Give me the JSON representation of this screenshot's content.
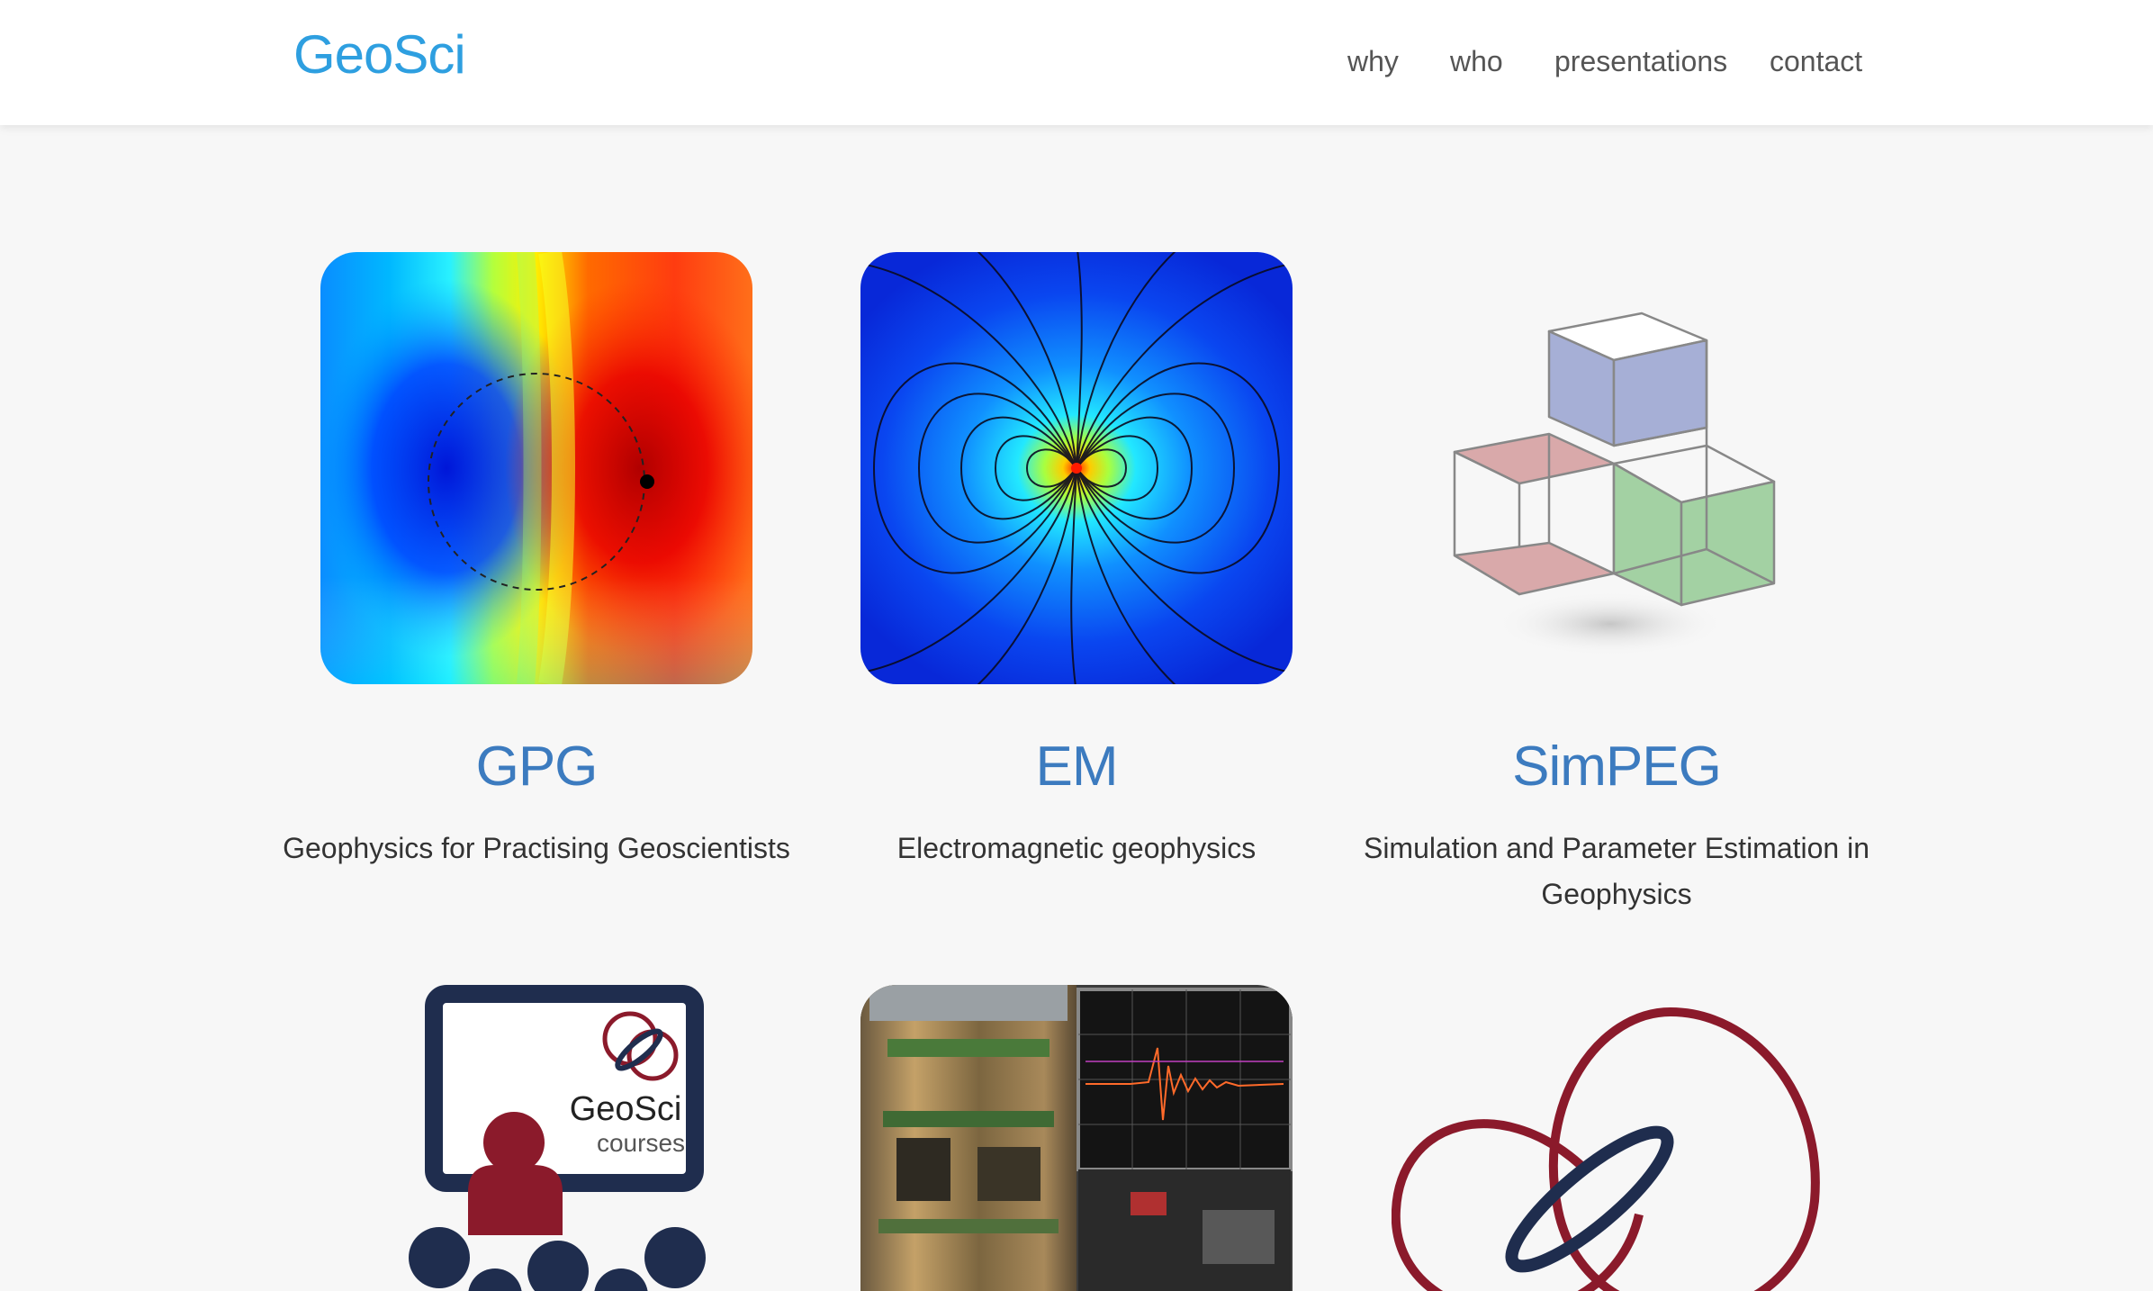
{
  "brand": "GeoSci",
  "nav": {
    "items": [
      "why",
      "who",
      "presentations",
      "contact"
    ]
  },
  "projects": [
    {
      "title": "GPG",
      "description": "Geophysics for Practising Geoscientists"
    },
    {
      "title": "EM",
      "description": "Electromagnetic geophysics"
    },
    {
      "title": "SimPEG",
      "description": "Simulation and Parameter Estimation in Geophysics"
    }
  ],
  "courses_logo": {
    "name": "GeoSci",
    "sub": "courses"
  },
  "colors": {
    "brand": "#2e9fe0",
    "title": "#3c7bbf",
    "navy": "#1f2d4e",
    "maroon": "#8b1a2b"
  }
}
